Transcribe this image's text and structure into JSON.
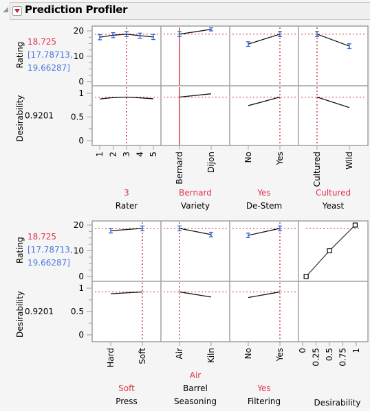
{
  "header": {
    "title": "Prediction Profiler",
    "menu_icon": "red-triangle-menu-icon",
    "disclosure_icon": "disclosure-triangle-icon"
  },
  "colors": {
    "current_value": "#e0344f",
    "ci": "#4a78e0",
    "errorbar": "#2a5fd8",
    "crosshair": "#d0202a",
    "line": "#000000",
    "frame": "#a0a0a0",
    "axis_text": "#000000"
  },
  "chart_data": {
    "type": "line",
    "title": "Prediction Profiler",
    "response": {
      "name": "Rating",
      "value": "18.725",
      "ci_low": "[17.78713,",
      "ci_high": "19.66287]",
      "current": 18.725,
      "ylim": [
        0,
        20
      ],
      "yticks": [
        "20",
        "10",
        "0"
      ]
    },
    "desirability": {
      "name": "Desirability",
      "value": "0.9201",
      "current": 0.9201,
      "ylim": [
        0,
        1
      ],
      "yticks": [
        "1",
        "0.5",
        "0"
      ]
    },
    "rows": [
      {
        "factors": [
          {
            "name": "Rater",
            "name_lines": [
              "Rater"
            ],
            "current_label": "3",
            "current_index": 2,
            "categories": [
              "1",
              "2",
              "3",
              "4",
              "5"
            ],
            "rating": [
              17.5,
              18.3,
              18.7,
              18.1,
              17.6
            ],
            "error": [
              1.0,
              1.0,
              0.95,
              1.0,
              1.0
            ],
            "desirability": [
              0.88,
              0.91,
              0.92,
              0.905,
              0.885
            ]
          },
          {
            "name": "Variety",
            "name_lines": [
              "Variety"
            ],
            "current_label": "Bernard",
            "current_index": 0,
            "categories": [
              "Bernard",
              "Dijon"
            ],
            "rating": [
              18.7,
              20.6
            ],
            "error": [
              0.95,
              0.6
            ],
            "desirability": [
              0.92,
              0.99
            ],
            "solid_crosshair": true
          },
          {
            "name": "De-Stem",
            "name_lines": [
              "De-Stem"
            ],
            "current_label": "Yes",
            "current_index": 1,
            "categories": [
              "No",
              "Yes"
            ],
            "rating": [
              14.8,
              18.7
            ],
            "error": [
              0.9,
              0.95
            ],
            "desirability": [
              0.74,
              0.92
            ]
          },
          {
            "name": "Yeast",
            "name_lines": [
              "Yeast"
            ],
            "current_label": "Cultured",
            "current_index": 0,
            "categories": [
              "Cultured",
              "Wild"
            ],
            "rating": [
              18.7,
              14.0
            ],
            "error": [
              0.95,
              0.9
            ],
            "desirability": [
              0.92,
              0.7
            ]
          }
        ]
      },
      {
        "factors": [
          {
            "name": "Press",
            "name_lines": [
              "Press"
            ],
            "current_label": "Soft",
            "current_index": 1,
            "categories": [
              "Hard",
              "Soft"
            ],
            "rating": [
              17.8,
              18.7
            ],
            "error": [
              0.9,
              0.95
            ],
            "desirability": [
              0.88,
              0.92
            ]
          },
          {
            "name": "Barrel Seasoning",
            "name_lines": [
              "Barrel",
              "Seasoning"
            ],
            "current_label": "Air",
            "current_index": 0,
            "categories": [
              "Air",
              "Kiln"
            ],
            "rating": [
              18.7,
              16.3
            ],
            "error": [
              0.95,
              0.9
            ],
            "desirability": [
              0.92,
              0.81
            ]
          },
          {
            "name": "Filtering",
            "name_lines": [
              "Filtering"
            ],
            "current_label": "Yes",
            "current_index": 1,
            "categories": [
              "No",
              "Yes"
            ],
            "rating": [
              16.0,
              18.7
            ],
            "error": [
              0.9,
              0.95
            ],
            "desirability": [
              0.8,
              0.92
            ]
          }
        ],
        "desirability_function": {
          "name": "Desirability",
          "xlim": [
            0,
            1
          ],
          "xticks": [
            "0",
            "0.25",
            "0.5",
            "0.75",
            "1"
          ],
          "points": [
            {
              "desirability": 0.066,
              "rating": 0
            },
            {
              "desirability": 0.5,
              "rating": 10
            },
            {
              "desirability": 0.98,
              "rating": 20
            }
          ]
        }
      }
    ]
  }
}
